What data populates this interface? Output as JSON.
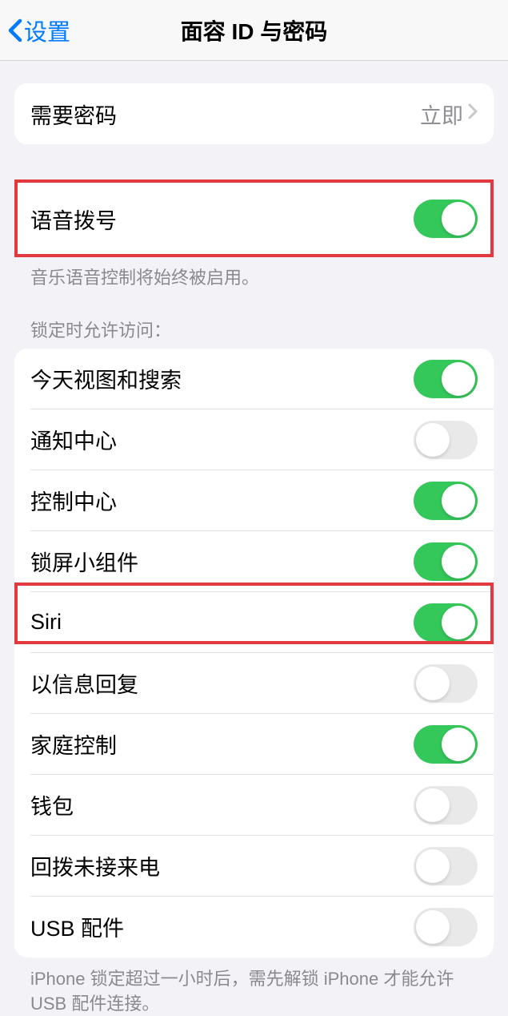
{
  "nav": {
    "back_label": "设置",
    "title": "面容 ID 与密码"
  },
  "passcode": {
    "require_label": "需要密码",
    "require_value": "立即"
  },
  "voice_dial": {
    "label": "语音拨号",
    "footer": "音乐语音控制将始终被启用。"
  },
  "locked_access": {
    "header": "锁定时允许访问：",
    "items": [
      {
        "label": "今天视图和搜索",
        "on": true
      },
      {
        "label": "通知中心",
        "on": false
      },
      {
        "label": "控制中心",
        "on": true
      },
      {
        "label": "锁屏小组件",
        "on": true
      },
      {
        "label": "Siri",
        "on": true
      },
      {
        "label": "以信息回复",
        "on": false
      },
      {
        "label": "家庭控制",
        "on": true
      },
      {
        "label": "钱包",
        "on": false
      },
      {
        "label": "回拨未接来电",
        "on": false
      },
      {
        "label": "USB 配件",
        "on": false
      }
    ],
    "footer": "iPhone 锁定超过一小时后，需先解锁 iPhone 才能允许 USB 配件连接。"
  }
}
